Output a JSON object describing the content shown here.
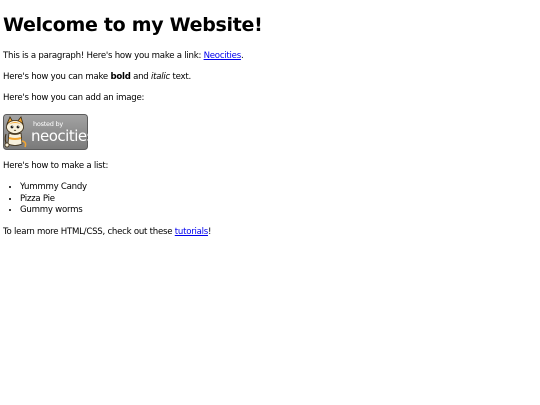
{
  "title": "Welcome to my Website!",
  "para1": {
    "prefix": "This is a paragraph! Here's how you make a link: ",
    "link": "Neocities",
    "suffix": "."
  },
  "para2": {
    "prefix": "Here's how you can make ",
    "bold": "bold",
    "middle": " and ",
    "italic": "italic",
    "suffix": " text."
  },
  "para3": "Here's how you can add an image:",
  "badge": {
    "icon": "neocities-cat-icon",
    "line1": "hosted by",
    "line2": "neocities",
    "colors": {
      "bg": "#8c8c8c",
      "bg_dark": "#6e6e6e",
      "text": "#ffffff",
      "cat": "#f2a531"
    }
  },
  "para4": "Here's how to make a list:",
  "list": [
    "Yummmy Candy",
    "Pizza Pie",
    "Gummy worms"
  ],
  "para5": {
    "prefix": "To learn more HTML/CSS, check out these ",
    "link": "tutorials",
    "suffix": "!"
  }
}
